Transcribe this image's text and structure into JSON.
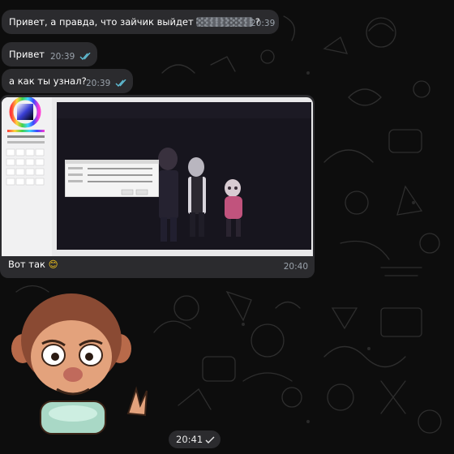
{
  "messages": [
    {
      "text": "Привет, а правда, что зайчик выйдет",
      "suffix": "?",
      "time": "20:39",
      "spoiler_text": "█████"
    },
    {
      "text": "Привет",
      "time": "20:39",
      "read": true
    },
    {
      "text": "а как ты узнал?",
      "time": "20:39",
      "read": true
    }
  ],
  "photo_message": {
    "caption": "Вот так",
    "emoji": "😊",
    "time": "20:40"
  },
  "sticker": {
    "time": "20:41",
    "read": true
  },
  "colors": {
    "bubble": "#2b2b2e",
    "meta": "#9aa2ab",
    "check": "#5fbcd3",
    "background": "#0d0d0d"
  }
}
